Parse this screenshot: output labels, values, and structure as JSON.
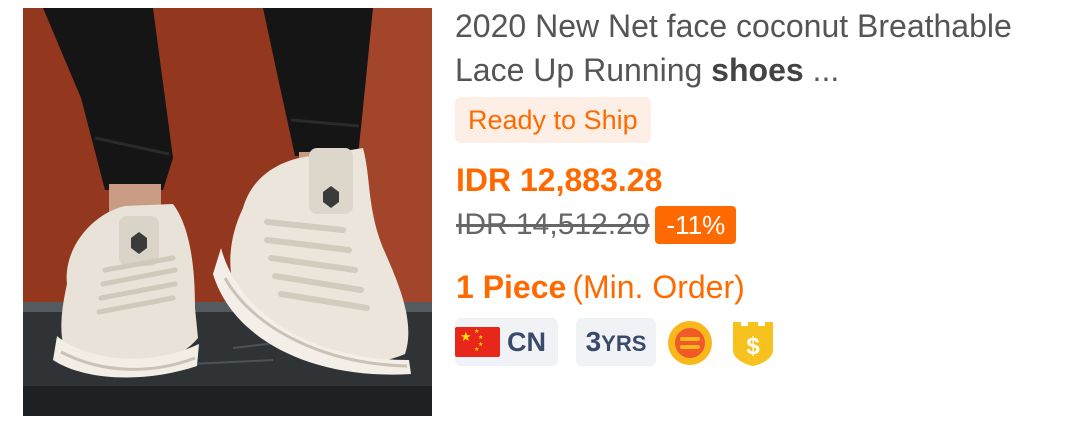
{
  "product": {
    "title_main": "2020 New Net face coconut Breathable Lace Up Running ",
    "title_keyword": "shoes",
    "title_ellipsis": " ...",
    "ship_badge": "Ready to Ship",
    "price": "IDR 12,883.28",
    "original_price": "IDR 14,512.20",
    "discount": "-11%",
    "min_order_qty": "1 Piece",
    "min_order_label": "(Min. Order)"
  },
  "supplier": {
    "country": "CN",
    "years_number": "3",
    "years_unit": "YRS",
    "medal_icon": "gold-supplier-medal-icon",
    "shield_icon": "trade-assurance-dollar-icon"
  },
  "colors": {
    "accent": "#ff6a00",
    "badge_bg": "#fdeee6",
    "chip_bg": "#f1f2f6",
    "chip_text": "#3a4a6a",
    "medal": "#f8b81c",
    "shield": "#f7c21e"
  }
}
